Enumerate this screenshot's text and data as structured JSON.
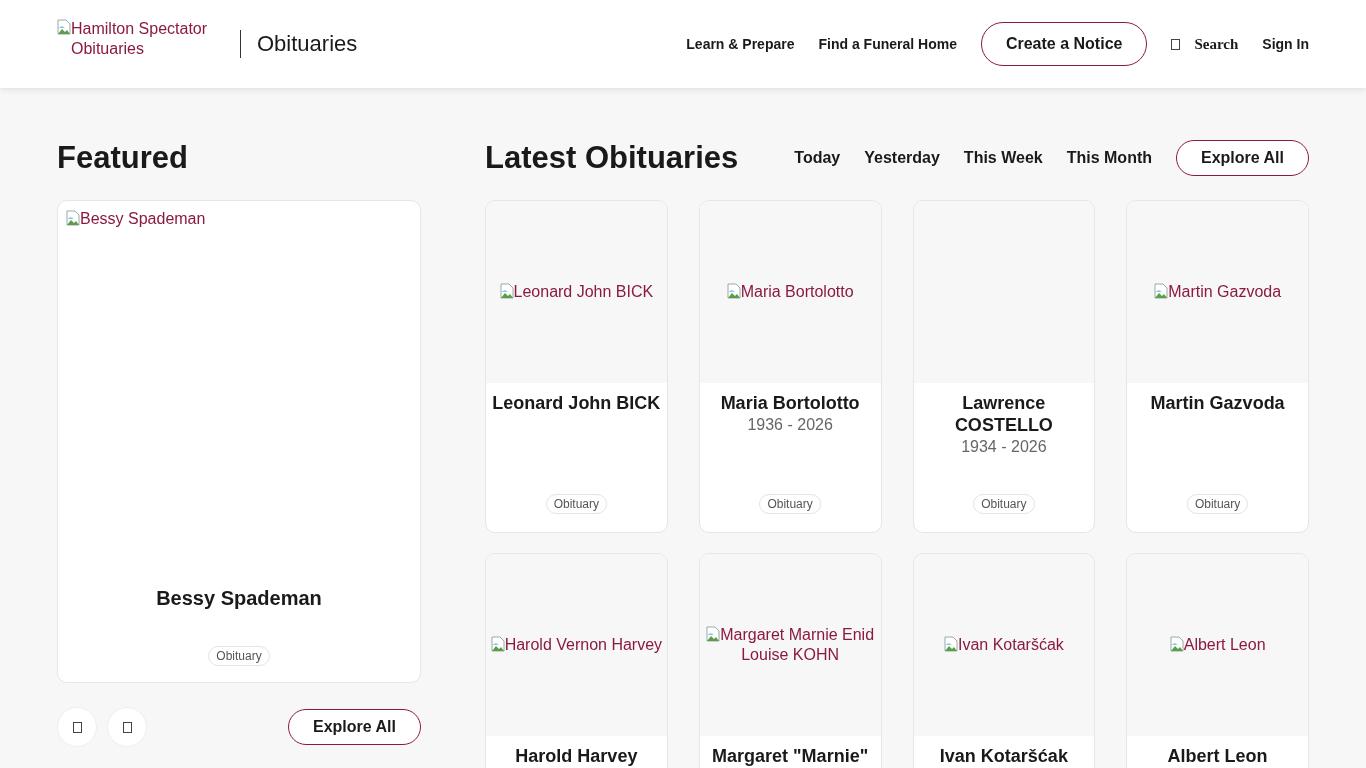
{
  "header": {
    "logo_alt": "Hamilton Spectator Obituaries",
    "section": "Obituaries",
    "nav": [
      "Learn & Prepare",
      "Find a Funeral Home"
    ],
    "cta": "Create a Notice",
    "search": "Search",
    "sign_in": "Sign In"
  },
  "featured": {
    "heading": "Featured",
    "card": {
      "image_alt": "Bessy Spademan",
      "name": "Bessy Spademan",
      "tag": "Obituary"
    },
    "explore": "Explore All"
  },
  "latest": {
    "heading": "Latest Obituaries",
    "filters": [
      "Today",
      "Yesterday",
      "This Week",
      "This Month"
    ],
    "explore": "Explore All",
    "cards": [
      {
        "image_alt": "Leonard John BICK",
        "name": "Leonard John BICK",
        "tag": "Obituary"
      },
      {
        "image_alt": "Maria Bortolotto",
        "name": "Maria Bortolotto",
        "dates": "1936 - 2026",
        "tag": "Obituary"
      },
      {
        "name": "Lawrence COSTELLO",
        "dates": "1934 - 2026",
        "tag": "Obituary"
      },
      {
        "image_alt": "Martin Gazvoda",
        "name": "Martin Gazvoda",
        "tag": "Obituary"
      },
      {
        "image_alt": "Harold Vernon Harvey",
        "name": "Harold Harvey"
      },
      {
        "image_alt": "Margaret Marnie Enid Louise KOHN",
        "name": "Margaret \"Marnie\""
      },
      {
        "image_alt": "Ivan Kotaršćak",
        "name": "Ivan Kotaršćak"
      },
      {
        "image_alt": "Albert Leon",
        "name": "Albert Leon"
      }
    ]
  }
}
